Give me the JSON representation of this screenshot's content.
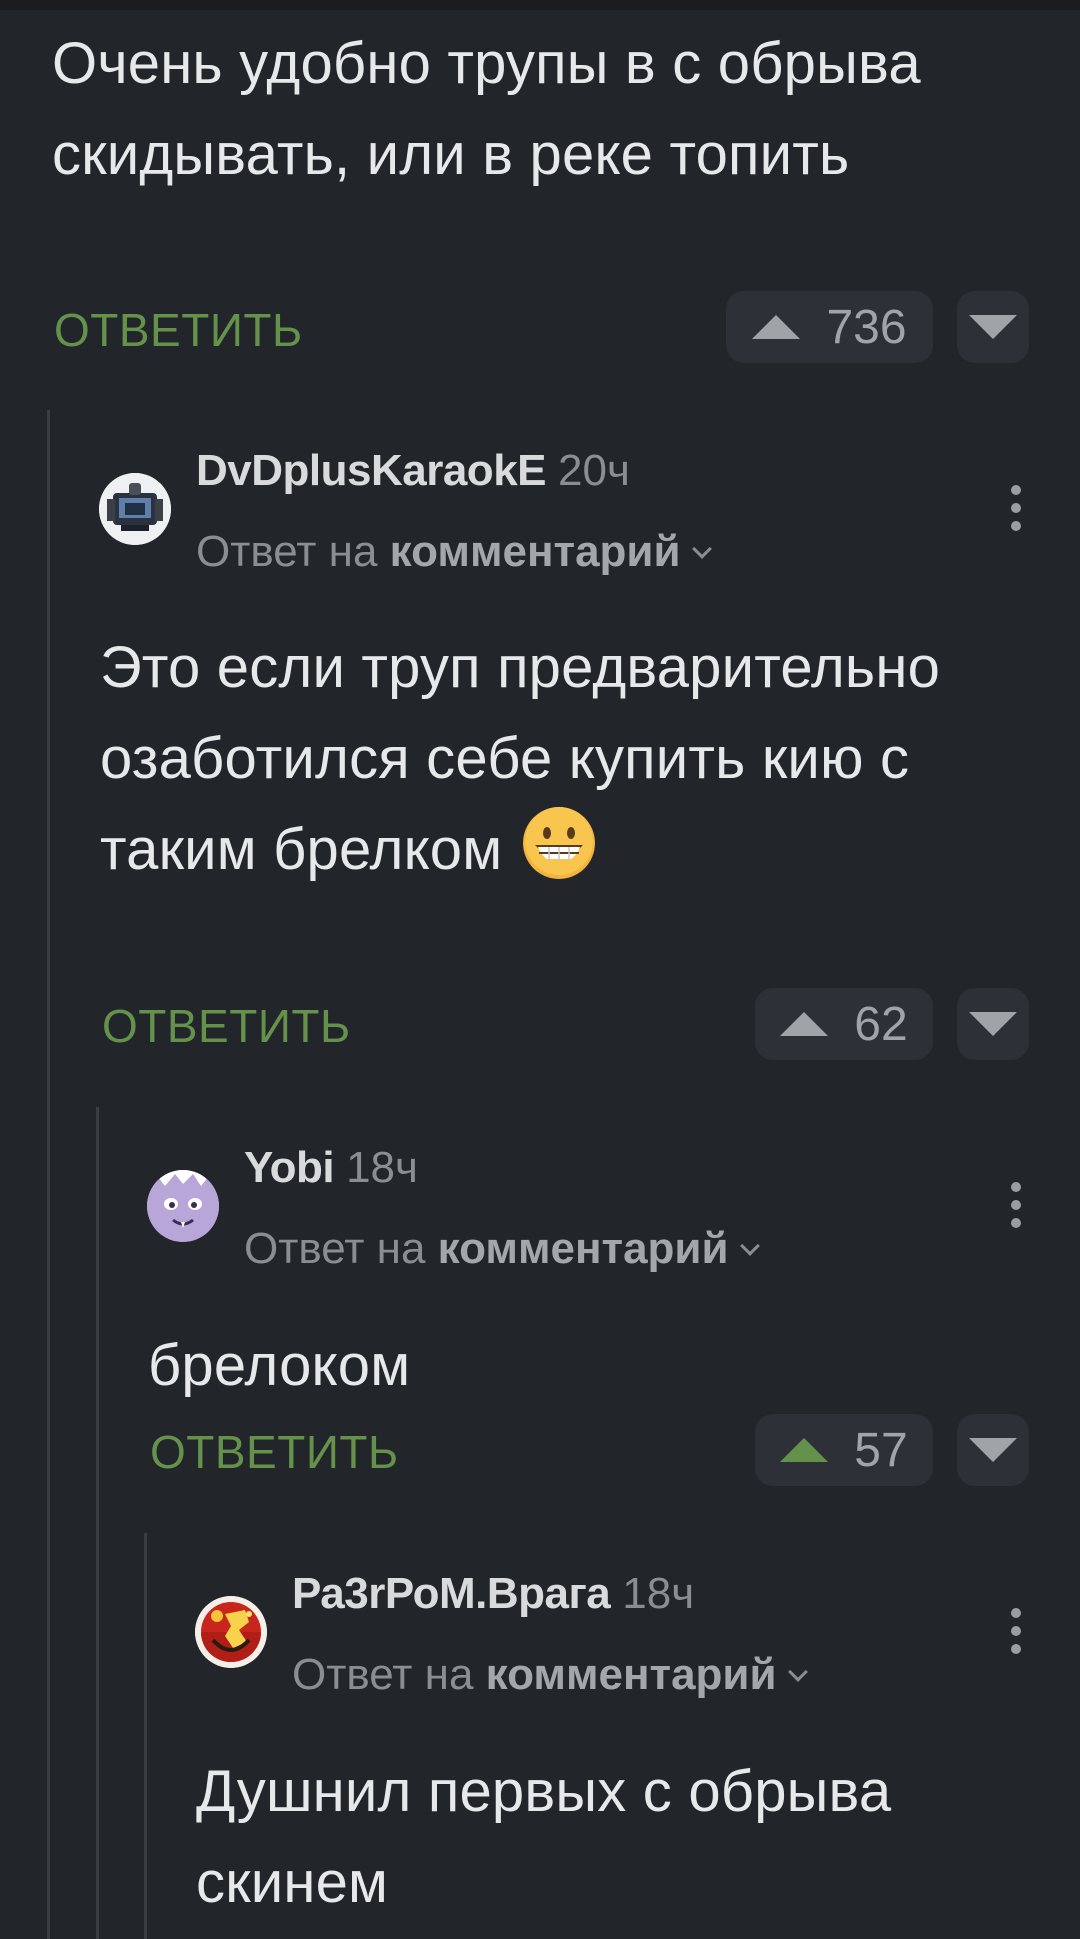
{
  "comments": [
    {
      "text": "Очень удобно трупы в с обрыва скидывать, или в реке топить",
      "reply_label": "ОТВЕТИТЬ",
      "votes": "736",
      "upvoted": false
    },
    {
      "author": "DvDplusKaraokE",
      "time": "20ч",
      "reply_to_prefix": "Ответ на",
      "reply_to_target": "комментарий",
      "text": "Это если труп предварительно озаботился себе купить кию с таким брелком",
      "emoji": "grinning-face-emoji",
      "reply_label": "ОТВЕТИТЬ",
      "votes": "62",
      "upvoted": false
    },
    {
      "author": "Yobi",
      "time": "18ч",
      "reply_to_prefix": "Ответ на",
      "reply_to_target": "комментарий",
      "text": "брелоком",
      "reply_label": "ОТВЕТИТЬ",
      "votes": "57",
      "upvoted": true
    },
    {
      "author": "Ра3rРоМ.Врага",
      "time": "18ч",
      "reply_to_prefix": "Ответ на",
      "reply_to_target": "комментарий",
      "text": "Душнил первых с обрыва скинем"
    }
  ],
  "colors": {
    "background": "#22252a",
    "accent_green": "#64924b",
    "vote_bg": "#2d3137"
  }
}
